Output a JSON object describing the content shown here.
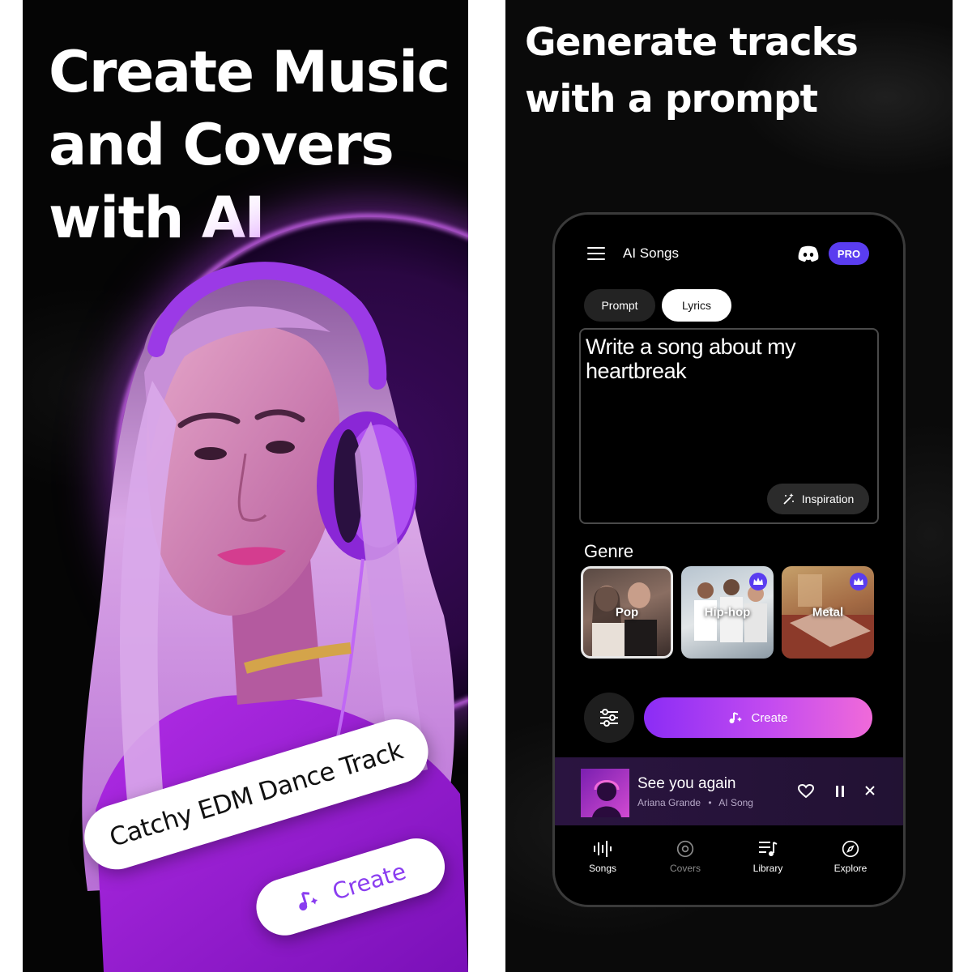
{
  "left_panel": {
    "headline": [
      "Create Music",
      "and Covers",
      "with AI"
    ],
    "prompt_example": "Catchy EDM Dance Track",
    "create_label": "Create"
  },
  "right_panel": {
    "headline": [
      "Generate tracks",
      "with a prompt"
    ],
    "app": {
      "title": "AI Songs",
      "pro_badge": "PRO",
      "tabs": [
        {
          "label": "Prompt",
          "active": false
        },
        {
          "label": "Lyrics",
          "active": true
        }
      ],
      "textarea_value": "Write a song about my heartbreak",
      "inspiration_label": "Inspiration",
      "genre_title": "Genre",
      "genres": [
        {
          "label": "Pop",
          "selected": true,
          "premium": false
        },
        {
          "label": "Hip-hop",
          "selected": false,
          "premium": true
        },
        {
          "label": "Metal",
          "selected": false,
          "premium": true
        }
      ],
      "create_label": "Create",
      "now_playing": {
        "title": "See you again",
        "artist": "Ariana Grande",
        "source": "AI Song"
      },
      "nav": [
        {
          "label": "Songs",
          "icon": "waveform-icon",
          "active": true
        },
        {
          "label": "Covers",
          "icon": "disc-icon",
          "active": false
        },
        {
          "label": "Library",
          "icon": "playlist-icon",
          "active": true
        },
        {
          "label": "Explore",
          "icon": "compass-icon",
          "active": true
        }
      ]
    }
  },
  "colors": {
    "accent_purple": "#5a3df0",
    "gradient_start": "#8b2cf5",
    "gradient_end": "#f06ad9",
    "glow": "#c14cf5"
  }
}
